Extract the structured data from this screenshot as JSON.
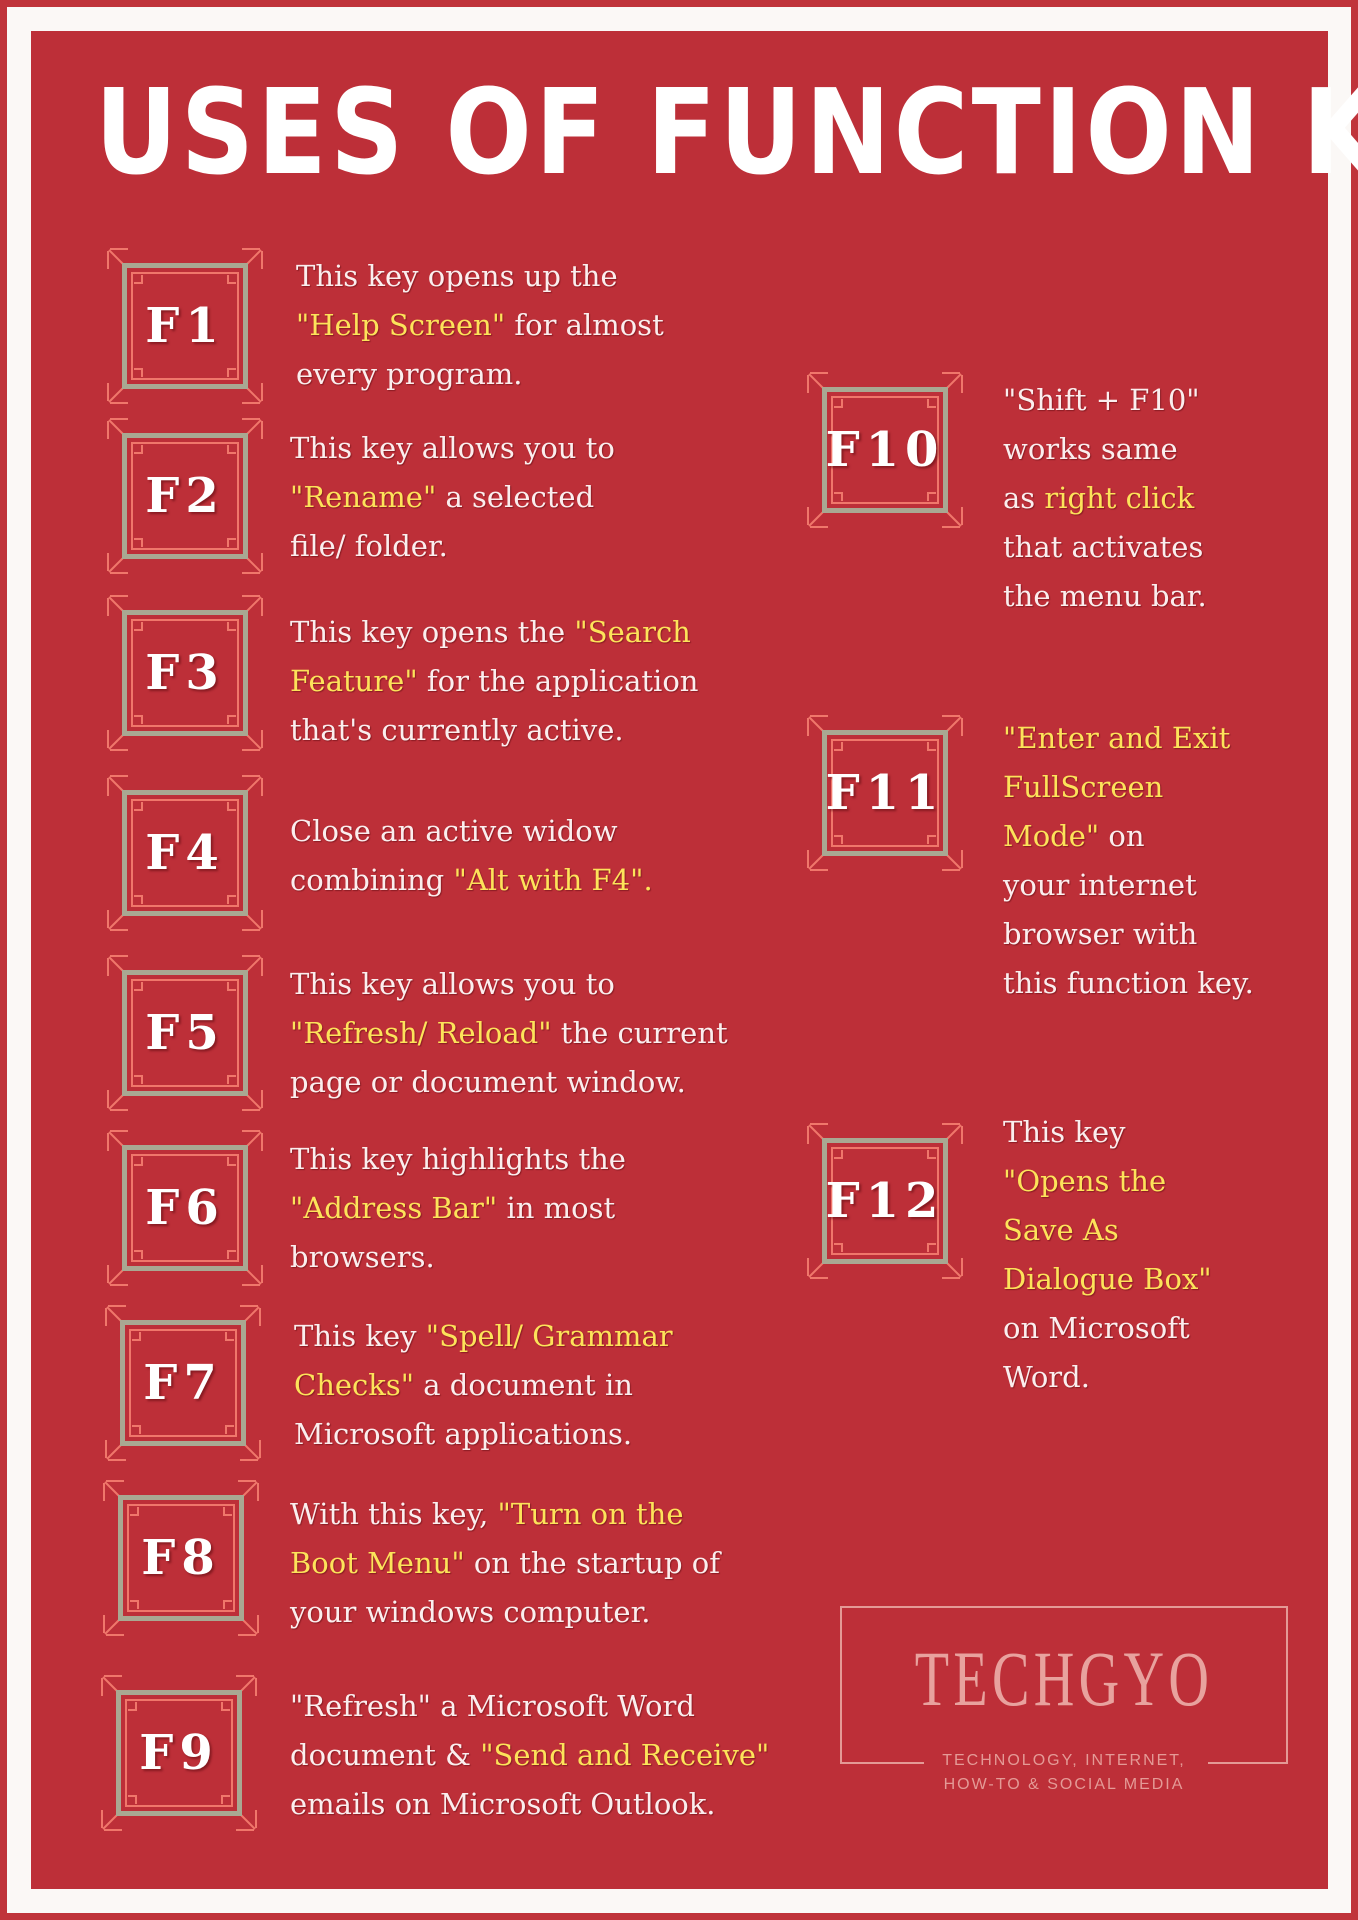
{
  "title": "USES OF FUNCTION KEYS",
  "colors": {
    "background": "#bd2f38",
    "highlight": "#fde35a",
    "text": "#fbeeee",
    "key_frame": "#a9a892",
    "key_accent": "#f0776b"
  },
  "keys": [
    {
      "id": "F1",
      "label": "F1",
      "lines": [
        [
          {
            "t": "This key opens up the"
          }
        ],
        [
          {
            "t": "\"Help Screen\"",
            "hl": true
          },
          {
            "t": " for almost"
          }
        ],
        [
          {
            "t": "every program."
          }
        ]
      ]
    },
    {
      "id": "F2",
      "label": "F2",
      "lines": [
        [
          {
            "t": "This key allows you to"
          }
        ],
        [
          {
            "t": "\"Rename\"",
            "hl": true
          },
          {
            "t": " a selected"
          }
        ],
        [
          {
            "t": "file/ folder."
          }
        ]
      ]
    },
    {
      "id": "F3",
      "label": "F3",
      "lines": [
        [
          {
            "t": "This key opens the "
          },
          {
            "t": "\"Search",
            "hl": true
          }
        ],
        [
          {
            "t": "Feature\"",
            "hl": true
          },
          {
            "t": " for the application"
          }
        ],
        [
          {
            "t": "that's currently active."
          }
        ]
      ]
    },
    {
      "id": "F4",
      "label": "F4",
      "lines": [
        [
          {
            "t": "Close an active widow"
          }
        ],
        [
          {
            "t": "combining "
          },
          {
            "t": "\"Alt with F4\".",
            "hl": true
          }
        ]
      ]
    },
    {
      "id": "F5",
      "label": "F5",
      "lines": [
        [
          {
            "t": "This key allows you to"
          }
        ],
        [
          {
            "t": "\"Refresh/ Reload\"",
            "hl": true
          },
          {
            "t": " the current"
          }
        ],
        [
          {
            "t": "page or document window."
          }
        ]
      ]
    },
    {
      "id": "F6",
      "label": "F6",
      "lines": [
        [
          {
            "t": "This key highlights the"
          }
        ],
        [
          {
            "t": "\"Address Bar\"",
            "hl": true
          },
          {
            "t": " in most"
          }
        ],
        [
          {
            "t": "browsers."
          }
        ]
      ]
    },
    {
      "id": "F7",
      "label": "F7",
      "lines": [
        [
          {
            "t": "This key "
          },
          {
            "t": "\"Spell/ Grammar",
            "hl": true
          }
        ],
        [
          {
            "t": "Checks\"",
            "hl": true
          },
          {
            "t": " a document in"
          }
        ],
        [
          {
            "t": "Microsoft applications."
          }
        ]
      ]
    },
    {
      "id": "F8",
      "label": "F8",
      "lines": [
        [
          {
            "t": "With this key, "
          },
          {
            "t": "\"Turn on the",
            "hl": true
          }
        ],
        [
          {
            "t": "Boot Menu\"",
            "hl": true
          },
          {
            "t": " on the startup of"
          }
        ],
        [
          {
            "t": "your windows computer."
          }
        ]
      ]
    },
    {
      "id": "F9",
      "label": "F9",
      "lines": [
        [
          {
            "t": "\"Refresh\" a Microsoft Word"
          }
        ],
        [
          {
            "t": "document & "
          },
          {
            "t": "\"Send and Receive\"",
            "hl": true
          }
        ],
        [
          {
            "t": "emails on Microsoft Outlook."
          }
        ]
      ]
    },
    {
      "id": "F10",
      "label": "F10",
      "lines": [
        [
          {
            "t": "\"Shift + F10\""
          }
        ],
        [
          {
            "t": "works same"
          }
        ],
        [
          {
            "t": "as "
          },
          {
            "t": "right click",
            "hl": true
          }
        ],
        [
          {
            "t": "that activates"
          }
        ],
        [
          {
            "t": "the menu bar."
          }
        ]
      ]
    },
    {
      "id": "F11",
      "label": "F11",
      "lines": [
        [
          {
            "t": "\"Enter and Exit",
            "hl": true
          }
        ],
        [
          {
            "t": "FullScreen",
            "hl": true
          }
        ],
        [
          {
            "t": "Mode\"",
            "hl": true
          },
          {
            "t": " on"
          }
        ],
        [
          {
            "t": "your internet"
          }
        ],
        [
          {
            "t": "browser with"
          }
        ],
        [
          {
            "t": "this function key."
          }
        ]
      ]
    },
    {
      "id": "F12",
      "label": "F12",
      "lines": [
        [
          {
            "t": "This key"
          }
        ],
        [
          {
            "t": "\"Opens the",
            "hl": true
          }
        ],
        [
          {
            "t": "Save As",
            "hl": true
          }
        ],
        [
          {
            "t": "Dialogue Box\"",
            "hl": true
          }
        ],
        [
          {
            "t": "on Microsoft"
          }
        ],
        [
          {
            "t": "Word."
          }
        ]
      ]
    }
  ],
  "logo": {
    "brand": "TECHGYO",
    "tagline_1": "TECHNOLOGY, INTERNET,",
    "tagline_2": "HOW-TO & SOCIAL MEDIA"
  }
}
